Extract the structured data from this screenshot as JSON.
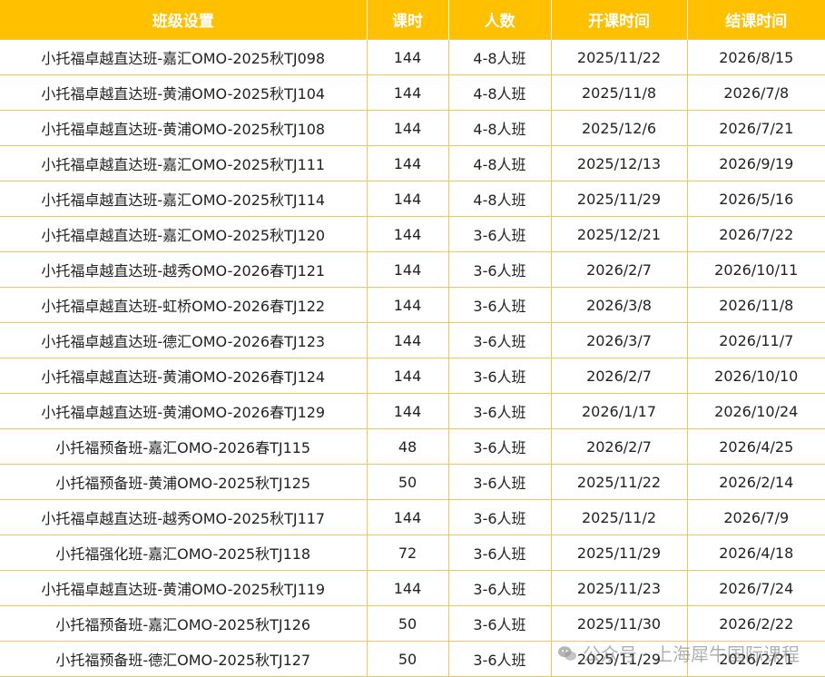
{
  "table": {
    "headers": [
      "班级设置",
      "课时",
      "人数",
      "开课时间",
      "结课时间"
    ],
    "rows": [
      [
        "小托福卓越直达班-嘉汇OMO-2025秋TJ098",
        "144",
        "4-8人班",
        "2025/11/22",
        "2026/8/15"
      ],
      [
        "小托福卓越直达班-黄浦OMO-2025秋TJ104",
        "144",
        "4-8人班",
        "2025/11/8",
        "2026/7/8"
      ],
      [
        "小托福卓越直达班-黄浦OMO-2025秋TJ108",
        "144",
        "4-8人班",
        "2025/12/6",
        "2026/7/21"
      ],
      [
        "小托福卓越直达班-嘉汇OMO-2025秋TJ111",
        "144",
        "4-8人班",
        "2025/12/13",
        "2026/9/19"
      ],
      [
        "小托福卓越直达班-嘉汇OMO-2025秋TJ114",
        "144",
        "4-8人班",
        "2025/11/29",
        "2026/5/16"
      ],
      [
        "小托福卓越直达班-嘉汇OMO-2025秋TJ120",
        "144",
        "3-6人班",
        "2025/12/21",
        "2026/7/22"
      ],
      [
        "小托福卓越直达班-越秀OMO-2026春TJ121",
        "144",
        "3-6人班",
        "2026/2/7",
        "2026/10/11"
      ],
      [
        "小托福卓越直达班-虹桥OMO-2026春TJ122",
        "144",
        "3-6人班",
        "2026/3/8",
        "2026/11/8"
      ],
      [
        "小托福卓越直达班-德汇OMO-2026春TJ123",
        "144",
        "3-6人班",
        "2026/3/7",
        "2026/11/7"
      ],
      [
        "小托福卓越直达班-黄浦OMO-2026春TJ124",
        "144",
        "3-6人班",
        "2026/2/7",
        "2026/10/10"
      ],
      [
        "小托福卓越直达班-黄浦OMO-2026春TJ129",
        "144",
        "3-6人班",
        "2026/1/17",
        "2026/10/24"
      ],
      [
        "小托福预备班-嘉汇OMO-2026春TJ115",
        "48",
        "3-6人班",
        "2026/2/7",
        "2026/4/25"
      ],
      [
        "小托福预备班-黄浦OMO-2025秋TJ125",
        "50",
        "3-6人班",
        "2025/11/22",
        "2026/2/14"
      ],
      [
        "小托福卓越直达班-越秀OMO-2025秋TJ117",
        "144",
        "3-6人班",
        "2025/11/2",
        "2026/7/9"
      ],
      [
        "小托福强化班-嘉汇OMO-2025秋TJ118",
        "72",
        "3-6人班",
        "2025/11/29",
        "2026/4/18"
      ],
      [
        "小托福卓越直达班-黄浦OMO-2025秋TJ119",
        "144",
        "3-6人班",
        "2025/11/23",
        "2026/7/24"
      ],
      [
        "小托福预备班-嘉汇OMO-2025秋TJ126",
        "50",
        "3-6人班",
        "2025/11/30",
        "2026/2/22"
      ],
      [
        "小托福预备班-德汇OMO-2025秋TJ127",
        "50",
        "3-6人班",
        "2025/11/29",
        "2026/2/21"
      ]
    ]
  },
  "watermark": {
    "text": "公众号 · 上海犀牛国际课程",
    "icon": "wechat-icon"
  },
  "colors": {
    "header_bg": "#ffc000",
    "header_text": "#ffffff",
    "grid_line": "#f2c55a"
  }
}
